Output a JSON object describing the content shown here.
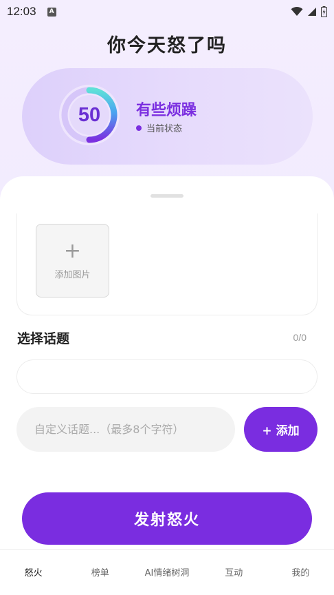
{
  "status_bar": {
    "time": "12:03",
    "notification_badge": "A",
    "icons": [
      "wifi-icon",
      "signal-icon",
      "battery-icon"
    ]
  },
  "header": {
    "title": "你今天怒了吗"
  },
  "mood": {
    "score": "50",
    "level_label": "有些烦躁",
    "status_label": "当前状态",
    "gauge_fraction": 0.5,
    "gauge_colors": [
      "#5fe0d8",
      "#4aa3f0",
      "#7b2fe0"
    ],
    "accent": "#7b2fe0"
  },
  "upload": {
    "add_icon": "plus-icon",
    "add_label": "添加图片"
  },
  "topic": {
    "title": "选择话题",
    "count": "0/0",
    "custom_placeholder": "自定义话题...（最多8个字符）",
    "custom_value": "",
    "add_button_label": "+ 添加"
  },
  "submit": {
    "label": "发射怒火",
    "color": "#7a2de0"
  },
  "tabbar": {
    "tabs": [
      {
        "label": "怒火",
        "active": true
      },
      {
        "label": "榜单",
        "active": false
      },
      {
        "label": "AI情绪树洞",
        "active": false
      },
      {
        "label": "互动",
        "active": false
      },
      {
        "label": "我的",
        "active": false
      }
    ]
  }
}
